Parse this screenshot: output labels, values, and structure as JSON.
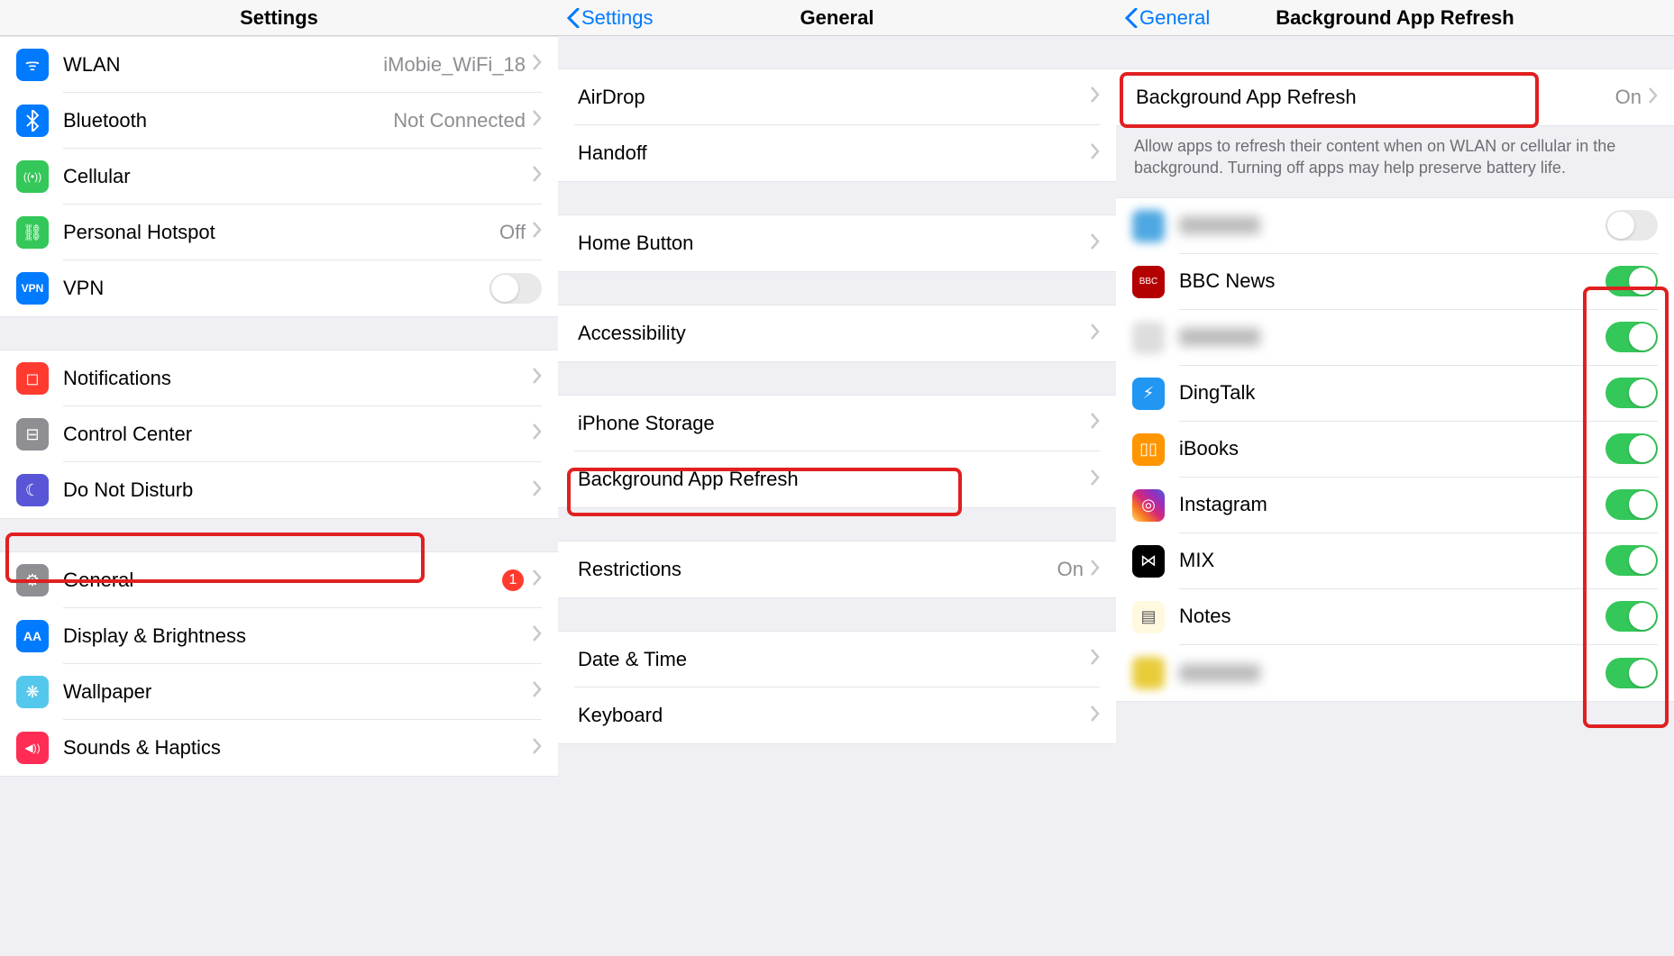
{
  "pane1": {
    "title": "Settings",
    "groups": [
      {
        "rows": [
          {
            "label": "WLAN",
            "value": "iMobie_WiFi_18",
            "icon_color": "#007aff",
            "icon_name": "wifi-icon",
            "chevron": true
          },
          {
            "label": "Bluetooth",
            "value": "Not Connected",
            "icon_color": "#007aff",
            "icon_name": "bluetooth-icon",
            "glyph": "✱",
            "chevron": true
          },
          {
            "label": "Cellular",
            "value": "",
            "icon_color": "#34c759",
            "icon_name": "cellular-icon",
            "glyph": "((•))",
            "chevron": true
          },
          {
            "label": "Personal Hotspot",
            "value": "Off",
            "icon_color": "#34c759",
            "icon_name": "hotspot-icon",
            "glyph": "⛓",
            "chevron": true
          },
          {
            "label": "VPN",
            "value": "",
            "icon_color": "#007aff",
            "icon_name": "vpn-icon",
            "glyph": "VPN",
            "toggle": false
          }
        ]
      },
      {
        "rows": [
          {
            "label": "Notifications",
            "icon_color": "#ff3b30",
            "icon_name": "notifications-icon",
            "glyph": "◻︎",
            "chevron": true
          },
          {
            "label": "Control Center",
            "icon_color": "#8e8e93",
            "icon_name": "control-center-icon",
            "glyph": "⊟",
            "chevron": true
          },
          {
            "label": "Do Not Disturb",
            "icon_color": "#5856d6",
            "icon_name": "dnd-icon",
            "glyph": "☾",
            "chevron": true
          }
        ]
      },
      {
        "rows": [
          {
            "label": "General",
            "icon_color": "#8e8e93",
            "icon_name": "general-icon",
            "glyph": "⚙︎",
            "badge": "1",
            "chevron": true,
            "highlighted": true
          },
          {
            "label": "Display & Brightness",
            "icon_color": "#007aff",
            "icon_name": "display-icon",
            "glyph": "AA",
            "chevron": true
          },
          {
            "label": "Wallpaper",
            "icon_color": "#54c7ec",
            "icon_name": "wallpaper-icon",
            "glyph": "❋",
            "chevron": true
          },
          {
            "label": "Sounds & Haptics",
            "icon_color": "#ff2d55",
            "icon_name": "sounds-icon",
            "glyph": "◀︎))",
            "chevron": true
          }
        ]
      }
    ]
  },
  "pane2": {
    "back": "Settings",
    "title": "General",
    "groups": [
      {
        "rows": [
          {
            "label": "AirDrop",
            "chevron": true
          },
          {
            "label": "Handoff",
            "chevron": true
          }
        ]
      },
      {
        "rows": [
          {
            "label": "Home Button",
            "chevron": true
          }
        ]
      },
      {
        "rows": [
          {
            "label": "Accessibility",
            "chevron": true
          }
        ]
      },
      {
        "rows": [
          {
            "label": "iPhone Storage",
            "chevron": true
          },
          {
            "label": "Background App Refresh",
            "chevron": true,
            "highlighted": true
          }
        ]
      },
      {
        "rows": [
          {
            "label": "Restrictions",
            "value": "On",
            "chevron": true
          }
        ]
      },
      {
        "rows": [
          {
            "label": "Date & Time",
            "chevron": true
          },
          {
            "label": "Keyboard",
            "chevron": true
          }
        ]
      }
    ]
  },
  "pane3": {
    "back": "General",
    "title": "Background App Refresh",
    "header_row": {
      "label": "Background App Refresh",
      "value": "On",
      "chevron": true,
      "highlighted": true
    },
    "footer": "Allow apps to refresh their content when on WLAN or cellular in the background. Turning off apps may help preserve battery life.",
    "apps": [
      {
        "label": "",
        "blur": true,
        "icon_color": "#4fa8e2",
        "toggle": false
      },
      {
        "label": "BBC News",
        "icon_color": "#b40000",
        "glyph": "BBC",
        "toggle": true
      },
      {
        "label": "",
        "blur": true,
        "icon_color": "#dddddd",
        "toggle": true
      },
      {
        "label": "DingTalk",
        "icon_color": "#2196f3",
        "glyph": "⚡︎",
        "toggle": true
      },
      {
        "label": "iBooks",
        "icon_color": "#ff9500",
        "glyph": "▯▯",
        "toggle": true
      },
      {
        "label": "Instagram",
        "icon_color": "linear",
        "glyph": "◎",
        "toggle": true
      },
      {
        "label": "MIX",
        "icon_color": "#000",
        "glyph": "⋈",
        "toggle": true
      },
      {
        "label": "Notes",
        "icon_color": "#fff9e0",
        "glyph": "▤",
        "toggle": true
      },
      {
        "label": "",
        "blur": true,
        "icon_color": "#e9cc3a",
        "toggle": true
      }
    ]
  }
}
